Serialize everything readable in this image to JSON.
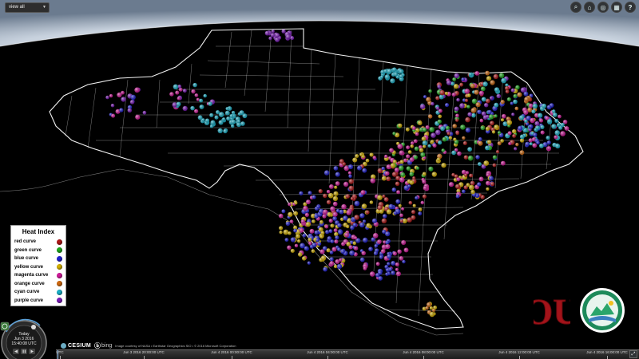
{
  "toolbar": {
    "view_select_label": "view all",
    "buttons": [
      {
        "name": "search-button",
        "icon": "search-icon",
        "glyph": "⌕"
      },
      {
        "name": "home-button",
        "icon": "home-icon",
        "glyph": "⌂"
      },
      {
        "name": "scene-mode-button",
        "icon": "globe-icon",
        "glyph": "◎"
      },
      {
        "name": "base-layer-picker-button",
        "icon": "imagery-icon",
        "glyph": "▦"
      },
      {
        "name": "help-button",
        "icon": "help-icon",
        "glyph": "?"
      }
    ]
  },
  "legend": {
    "title": "Heat Index",
    "items": [
      {
        "label": "red curve",
        "color": "#b01818"
      },
      {
        "label": "green curve",
        "color": "#1da81d"
      },
      {
        "label": "blue curve",
        "color": "#2020d0"
      },
      {
        "label": "yellow curve",
        "color": "#d4b000"
      },
      {
        "label": "magenta curve",
        "color": "#d01a9a"
      },
      {
        "label": "orange curve",
        "color": "#d06a10"
      },
      {
        "label": "cyan curve",
        "color": "#1ab0c8"
      },
      {
        "label": "purple curve",
        "color": "#7a1ab8"
      }
    ]
  },
  "clock": {
    "label": "Today",
    "date": "Jun 3 2016",
    "time": "15:40:08 UTC"
  },
  "credits": {
    "cesium": "CESIUM",
    "bing": "bing",
    "text": "Image courtesy of NASA • Earthstar Geographics SIO • © 2016 Microsoft Corporation"
  },
  "timeline": {
    "ticks": [
      "UTC",
      "Jun 3 2016 20:00:00 UTC",
      "Jun 4 2016 00:00:00 UTC",
      "Jun 4 2016 04:00:00 UTC",
      "Jun 4 2016 08:00:00 UTC",
      "Jun 4 2016 12:00:00 UTC",
      "Jun 4 2016 16:00:00 UTC"
    ]
  },
  "logos": {
    "ou": "OU"
  },
  "colors": {
    "background": "#000000",
    "map_outline": "#ffffff",
    "sky_glow": "#dfe6ee"
  }
}
